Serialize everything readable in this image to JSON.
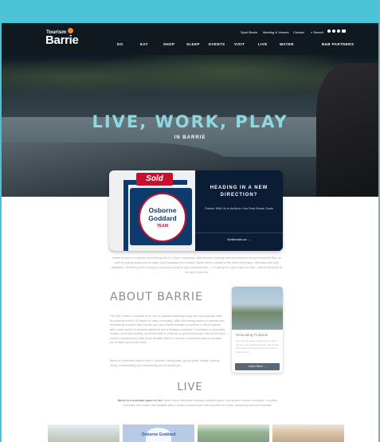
{
  "brand": {
    "logo_top": "Tourism",
    "logo_main": "Barrie"
  },
  "utility_nav": [
    "Sport Barrie",
    "Meeting & Venues",
    "Contact",
    "Search"
  ],
  "social_icons": [
    "instagram-icon",
    "pinterest-icon",
    "facebook-icon",
    "youtube-icon"
  ],
  "main_nav": [
    "DO",
    "EAT",
    "SHOP",
    "SLEEP",
    "EVENTS",
    "VISIT",
    "LIVE",
    "WATER",
    "B&B PARTNERS"
  ],
  "hero": {
    "title": "LIVE, WORK, PLAY",
    "subtitle": "IN BARRIE"
  },
  "ad_card": {
    "sign_label": "Sold",
    "badge_lines": [
      "Osborne",
      "Goddard",
      "TEAM"
    ],
    "heading": "HEADING IN A NEW DIRECTION?",
    "text": "Partner With Us to Achieve Your Real Estate Goals",
    "link": "NoWorries.ca  →"
  },
  "intro_text": "Barrie is home to a vibrant and thriving Arts & Culture community. With beautiful walking trails and beaches along Kempenfelt Bay, as well as cycling routes and an idyllic rural landscape just outside, Barrie offers a quality of life that's refreshing, restorative and very attainable. Whether you're looking to move your family or your business here – or looking for a great place to start – Barrie should be at the top of your list.",
  "about": {
    "heading": "ABOUT BARRIE",
    "para1": "The City of Barrie continues to be one of Canada's fastest growing and most dynamic cities. Its proximity to the GTA allows for easy commuting, while still offering access to beaches and recreational activities right outside your door. Barrie manages to achieve a critical balance, with a wide variety of beautiful waterfront and a heritage downtown. It maintains a community-minded, small town feeling, yet all the while it continues to grow and prosper with all of today's modern conveniences. With these benefits, Barrie is not only a wonderful place to vacation, but an ideal spot to call home.",
    "para2": "Barrie is a desirable place to live in. Beaches, hiking trails, cycling paths, fishing, boating, skiing, snowmobiling and snowshoeing are all around you."
  },
  "welcome_card": {
    "title": "Relocating To Barrie",
    "text": "See our relocation guide to learn about the city, the neighbourhoods, and to find information about local housing options and services.",
    "button": "Learn More  →"
  },
  "live": {
    "heading": "LIVE",
    "bold": "Barrie is a desirable place to live.",
    "text": " Barrie offers affordable housing, beautiful parks, four-season outdoor recreation, excellent education and health care facilities with a vibrant cultural scene that includes live music, performing arts and festivals."
  },
  "tiles": [
    {
      "name": "waterfront-photo",
      "label": ""
    },
    {
      "name": "osborne-goddard-tile",
      "label": "Osborne Goddard"
    },
    {
      "name": "go-train-photo",
      "label": ""
    },
    {
      "name": "autumn-house-photo",
      "label": ""
    }
  ],
  "colors": {
    "accent": "#8fd8e0",
    "frame": "#48c2d4",
    "header": "#101820",
    "card_navy": "#0a1d35",
    "sold_red": "#c8102e"
  }
}
